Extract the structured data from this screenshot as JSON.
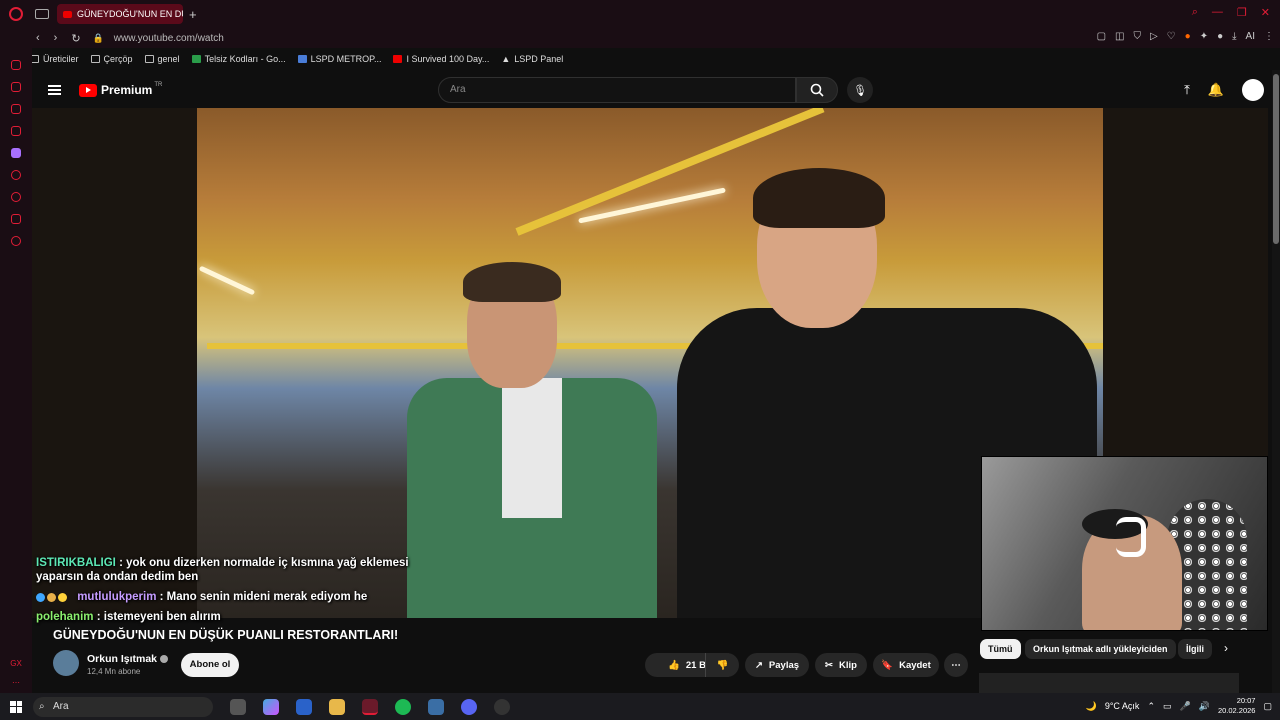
{
  "browser": {
    "active_tab_title": "GÜNEYDOĞU'NUN EN DÜŞ",
    "url": "www.youtube.com/watch",
    "address_icons_ai": "AI",
    "bookmarks": [
      "Üreticiler",
      "Çerçöp",
      "genel",
      "Telsiz Kodları - Go...",
      "LSPD METROP...",
      "I Survived 100 Day...",
      "LSPD Panel"
    ]
  },
  "yt": {
    "brand": "Premium",
    "region": "TR",
    "search_placeholder": "Ara"
  },
  "chat": [
    {
      "user": "ISTIRIKBALIGI",
      "message": ": yok onu dizerken normalde iç kısmına yağ eklemesi yaparsın da ondan dedim ben"
    },
    {
      "user": "mutlulukperim",
      "message": ": Mano senin mideni merak ediyom he"
    },
    {
      "user": "polehanim",
      "message": ": istemeyeni ben alırım"
    }
  ],
  "video": {
    "title": "GÜNEYDOĞU'NUN EN DÜŞÜK PUANLI RESTORANTLARI!",
    "channel": "Orkun Işıtmak",
    "subscribers": "12,4 Mn abone",
    "subscribe_label": "Abone ol",
    "likes": "21 B",
    "share_label": "Paylaş",
    "clip_label": "Klip",
    "save_label": "Kaydet"
  },
  "chips": [
    "Tümü",
    "Orkun Işıtmak adlı yükleyiciden",
    "İlgili"
  ],
  "taskbar": {
    "search_placeholder": "Ara",
    "weather": "9°C  Açık",
    "time": "20:07",
    "date": "20.02.2026"
  },
  "colors": {
    "accent": "#e11d36",
    "youtube_red": "#ff0000",
    "chat_green": "#8bf06e",
    "chat_purple": "#c59cff"
  }
}
